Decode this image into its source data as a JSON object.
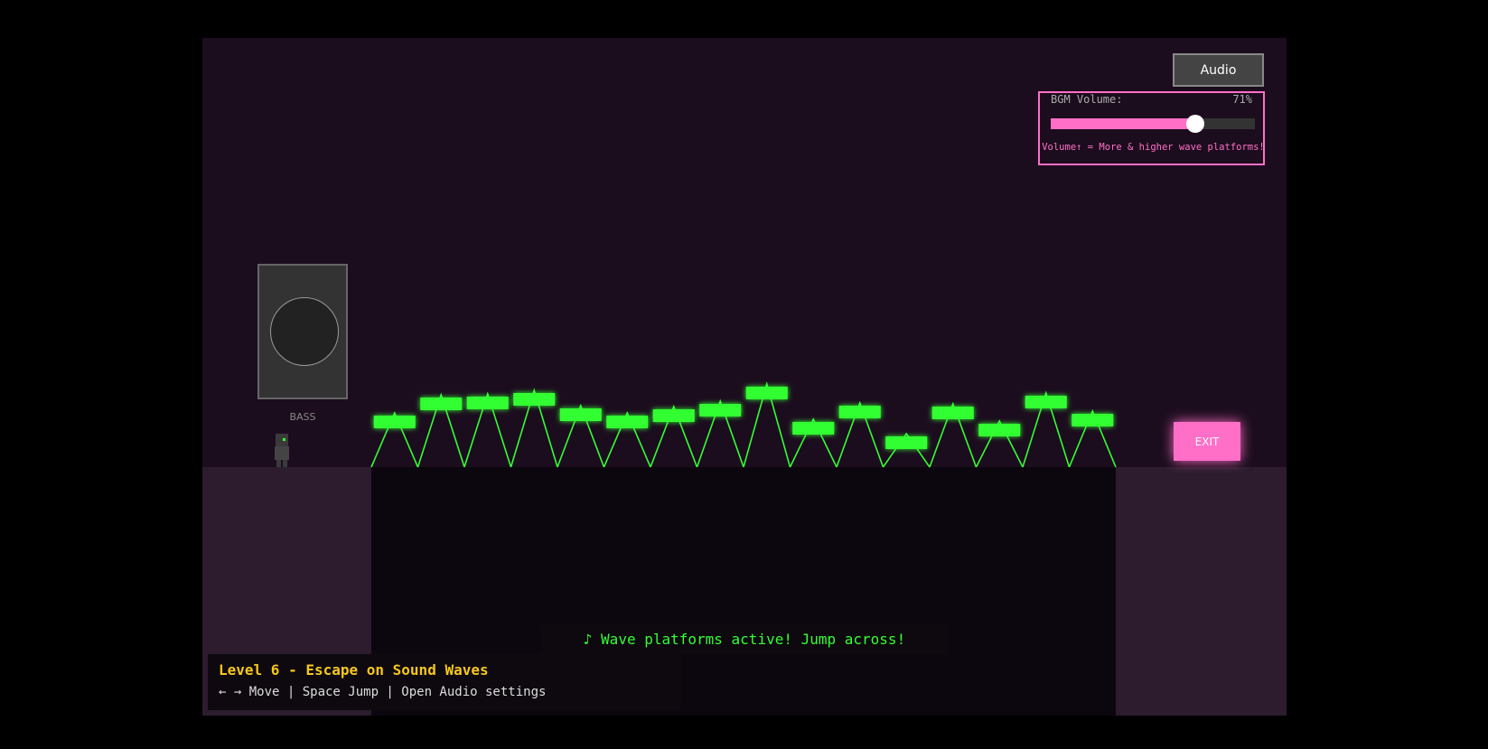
{
  "audio_button": {
    "label": "Audio"
  },
  "audio_panel": {
    "volume_label": "BGM Volume:",
    "volume_value_text": "71%",
    "volume_level": 0.71,
    "hint": "Volume↑ = More & higher wave platforms!"
  },
  "speaker": {
    "label": "BASS"
  },
  "exit": {
    "label": "EXIT"
  },
  "status": {
    "message": "♪ Wave platforms active! Jump across!"
  },
  "level_info": {
    "title": "Level 6 - Escape on Sound Waves",
    "controls": "← → Move | Space Jump | Open Audio settings"
  },
  "wave_platforms": {
    "count": 16,
    "heights": [
      60,
      80,
      81,
      85,
      68,
      60,
      67,
      73,
      92,
      53,
      71,
      37,
      70,
      51,
      82,
      62
    ]
  },
  "colors": {
    "accent_pink": "#ff6ec7",
    "wave_green": "#3f3",
    "title_yellow": "#f7c71c",
    "background": "#1c0d1e"
  }
}
